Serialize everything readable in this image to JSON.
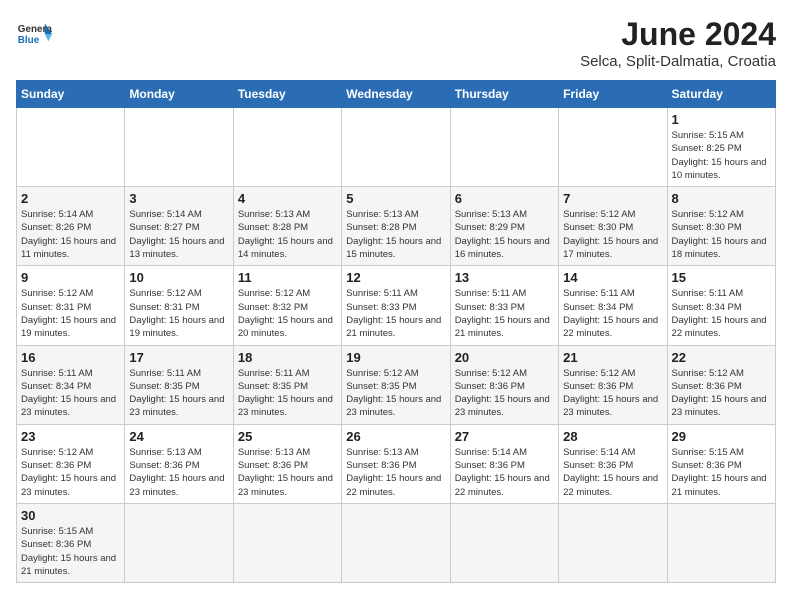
{
  "header": {
    "logo_general": "General",
    "logo_blue": "Blue",
    "title": "June 2024",
    "subtitle": "Selca, Split-Dalmatia, Croatia"
  },
  "weekdays": [
    "Sunday",
    "Monday",
    "Tuesday",
    "Wednesday",
    "Thursday",
    "Friday",
    "Saturday"
  ],
  "weeks": [
    [
      {
        "day": "",
        "info": ""
      },
      {
        "day": "",
        "info": ""
      },
      {
        "day": "",
        "info": ""
      },
      {
        "day": "",
        "info": ""
      },
      {
        "day": "",
        "info": ""
      },
      {
        "day": "",
        "info": ""
      },
      {
        "day": "1",
        "info": "Sunrise: 5:15 AM\nSunset: 8:25 PM\nDaylight: 15 hours and 10 minutes."
      }
    ],
    [
      {
        "day": "2",
        "info": "Sunrise: 5:14 AM\nSunset: 8:26 PM\nDaylight: 15 hours and 11 minutes."
      },
      {
        "day": "3",
        "info": "Sunrise: 5:14 AM\nSunset: 8:27 PM\nDaylight: 15 hours and 13 minutes."
      },
      {
        "day": "4",
        "info": "Sunrise: 5:13 AM\nSunset: 8:28 PM\nDaylight: 15 hours and 14 minutes."
      },
      {
        "day": "5",
        "info": "Sunrise: 5:13 AM\nSunset: 8:28 PM\nDaylight: 15 hours and 15 minutes."
      },
      {
        "day": "6",
        "info": "Sunrise: 5:13 AM\nSunset: 8:29 PM\nDaylight: 15 hours and 16 minutes."
      },
      {
        "day": "7",
        "info": "Sunrise: 5:12 AM\nSunset: 8:30 PM\nDaylight: 15 hours and 17 minutes."
      },
      {
        "day": "8",
        "info": "Sunrise: 5:12 AM\nSunset: 8:30 PM\nDaylight: 15 hours and 18 minutes."
      }
    ],
    [
      {
        "day": "9",
        "info": "Sunrise: 5:12 AM\nSunset: 8:31 PM\nDaylight: 15 hours and 19 minutes."
      },
      {
        "day": "10",
        "info": "Sunrise: 5:12 AM\nSunset: 8:31 PM\nDaylight: 15 hours and 19 minutes."
      },
      {
        "day": "11",
        "info": "Sunrise: 5:12 AM\nSunset: 8:32 PM\nDaylight: 15 hours and 20 minutes."
      },
      {
        "day": "12",
        "info": "Sunrise: 5:11 AM\nSunset: 8:33 PM\nDaylight: 15 hours and 21 minutes."
      },
      {
        "day": "13",
        "info": "Sunrise: 5:11 AM\nSunset: 8:33 PM\nDaylight: 15 hours and 21 minutes."
      },
      {
        "day": "14",
        "info": "Sunrise: 5:11 AM\nSunset: 8:34 PM\nDaylight: 15 hours and 22 minutes."
      },
      {
        "day": "15",
        "info": "Sunrise: 5:11 AM\nSunset: 8:34 PM\nDaylight: 15 hours and 22 minutes."
      }
    ],
    [
      {
        "day": "16",
        "info": "Sunrise: 5:11 AM\nSunset: 8:34 PM\nDaylight: 15 hours and 23 minutes."
      },
      {
        "day": "17",
        "info": "Sunrise: 5:11 AM\nSunset: 8:35 PM\nDaylight: 15 hours and 23 minutes."
      },
      {
        "day": "18",
        "info": "Sunrise: 5:11 AM\nSunset: 8:35 PM\nDaylight: 15 hours and 23 minutes."
      },
      {
        "day": "19",
        "info": "Sunrise: 5:12 AM\nSunset: 8:35 PM\nDaylight: 15 hours and 23 minutes."
      },
      {
        "day": "20",
        "info": "Sunrise: 5:12 AM\nSunset: 8:36 PM\nDaylight: 15 hours and 23 minutes."
      },
      {
        "day": "21",
        "info": "Sunrise: 5:12 AM\nSunset: 8:36 PM\nDaylight: 15 hours and 23 minutes."
      },
      {
        "day": "22",
        "info": "Sunrise: 5:12 AM\nSunset: 8:36 PM\nDaylight: 15 hours and 23 minutes."
      }
    ],
    [
      {
        "day": "23",
        "info": "Sunrise: 5:12 AM\nSunset: 8:36 PM\nDaylight: 15 hours and 23 minutes."
      },
      {
        "day": "24",
        "info": "Sunrise: 5:13 AM\nSunset: 8:36 PM\nDaylight: 15 hours and 23 minutes."
      },
      {
        "day": "25",
        "info": "Sunrise: 5:13 AM\nSunset: 8:36 PM\nDaylight: 15 hours and 23 minutes."
      },
      {
        "day": "26",
        "info": "Sunrise: 5:13 AM\nSunset: 8:36 PM\nDaylight: 15 hours and 22 minutes."
      },
      {
        "day": "27",
        "info": "Sunrise: 5:14 AM\nSunset: 8:36 PM\nDaylight: 15 hours and 22 minutes."
      },
      {
        "day": "28",
        "info": "Sunrise: 5:14 AM\nSunset: 8:36 PM\nDaylight: 15 hours and 22 minutes."
      },
      {
        "day": "29",
        "info": "Sunrise: 5:15 AM\nSunset: 8:36 PM\nDaylight: 15 hours and 21 minutes."
      }
    ],
    [
      {
        "day": "30",
        "info": "Sunrise: 5:15 AM\nSunset: 8:36 PM\nDaylight: 15 hours and 21 minutes."
      },
      {
        "day": "",
        "info": ""
      },
      {
        "day": "",
        "info": ""
      },
      {
        "day": "",
        "info": ""
      },
      {
        "day": "",
        "info": ""
      },
      {
        "day": "",
        "info": ""
      },
      {
        "day": "",
        "info": ""
      }
    ]
  ]
}
